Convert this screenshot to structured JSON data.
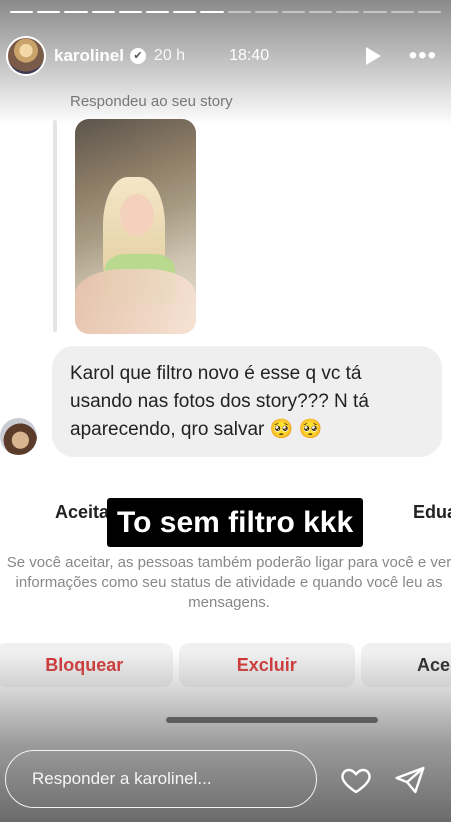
{
  "story": {
    "username": "karolinel",
    "verified_mark": "✔",
    "posted_ago": "20 h",
    "clock_time": "18:40",
    "more_glyph": "•••",
    "progress_segments_total": 16,
    "progress_segments_done": 8
  },
  "dm": {
    "replied_label": "Respondeu ao seu story",
    "message_text": "Karol que filtro novo é esse q vc tá usando nas fotos dos story??? N tá aparecendo, qro salvar 🥺 🥺"
  },
  "overlay": {
    "caption": "To sem filtro kkk"
  },
  "request": {
    "accept_left": "Aceitar",
    "accept_right": "Eduar",
    "info_text": "Se você aceitar, as pessoas também poderão ligar para você e ver informações como seu status de atividade e quando você leu as mensagens.",
    "buttons": {
      "block": "Bloquear",
      "delete": "Excluir",
      "accept": "Aceitar"
    }
  },
  "footer": {
    "reply_placeholder": "Responder a karolinel...",
    "icons": {
      "like": "heart-icon",
      "send": "send-icon"
    }
  },
  "colors": {
    "danger": "#d32f2f",
    "caption_bg": "#000000"
  }
}
